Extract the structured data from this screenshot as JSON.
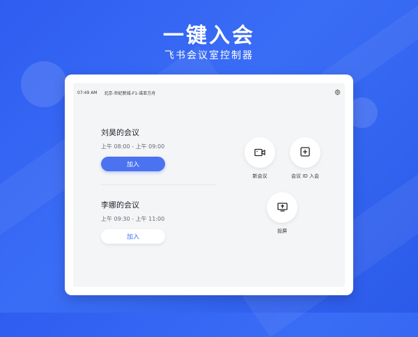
{
  "hero": {
    "title": "一键入会",
    "subtitle": "飞书会议室控制器"
  },
  "status_bar": {
    "time": "07:49 AM",
    "room": "北京-世纪新城-F1-诺亚方舟",
    "settings_icon": "gear-icon"
  },
  "meetings": [
    {
      "title": "刘昊的会议",
      "time": "上午 08:00 - 上午 09:00",
      "join_label": "加入",
      "style": "primary"
    },
    {
      "title": "李娜的会议",
      "time": "上午 09:30 - 上午 11:00",
      "join_label": "加入",
      "style": "secondary"
    }
  ],
  "actions": {
    "new_meeting": {
      "label": "新会议",
      "icon": "video-camera-icon"
    },
    "join_by_id": {
      "label": "会议 ID 入会",
      "icon": "plus-square-icon"
    },
    "screen_share": {
      "label": "投屏",
      "icon": "screen-share-icon"
    }
  },
  "colors": {
    "background": "#3366f0",
    "primary_button": "#4b73f0",
    "secondary_button_text": "#3b6ef0"
  }
}
